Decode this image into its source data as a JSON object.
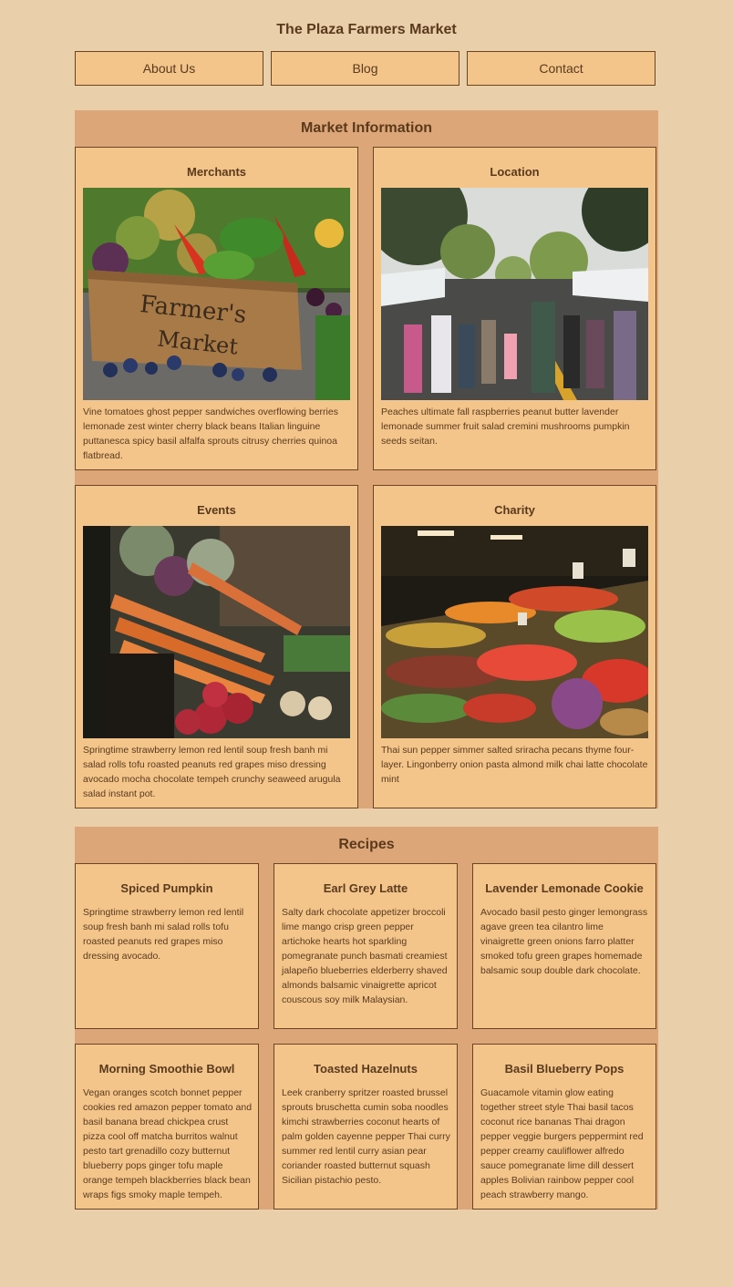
{
  "header": {
    "title": "The Plaza Farmers Market"
  },
  "nav": {
    "items": [
      "About Us",
      "Blog",
      "Contact"
    ]
  },
  "market": {
    "title": "Market Information",
    "cards": [
      {
        "title": "Merchants",
        "image": "farmers-market-crate-photo",
        "text": "Vine tomatoes ghost pepper sandwiches overflowing berries lemonade zest winter cherry black beans Italian linguine puttanesca spicy basil alfalfa sprouts citrusy cherries quinoa flatbread."
      },
      {
        "title": "Location",
        "image": "street-market-crowd-photo",
        "text": "Peaches ultimate fall raspberries peanut butter lavender lemonade summer fruit salad cremini mushrooms pumpkin seeds seitan."
      },
      {
        "title": "Events",
        "image": "carrots-radishes-photo",
        "text": "Springtime strawberry lemon red lentil soup fresh banh mi salad rolls tofu roasted peanuts red grapes miso dressing avocado mocha chocolate tempeh crunchy seaweed arugula salad instant pot."
      },
      {
        "title": "Charity",
        "image": "produce-stand-photo",
        "text": "Thai sun pepper simmer salted sriracha pecans thyme four-layer. Lingonberry onion pasta almond milk chai latte chocolate mint"
      }
    ]
  },
  "recipes": {
    "title": "Recipes",
    "cards": [
      {
        "title": "Spiced Pumpkin",
        "text": "Springtime strawberry lemon red lentil soup fresh banh mi salad rolls tofu roasted peanuts red grapes miso dressing avocado."
      },
      {
        "title": "Earl Grey Latte",
        "text": "Salty dark chocolate appetizer broccoli lime mango crisp green pepper artichoke hearts hot sparkling pomegranate punch basmati creamiest jalapeño blueberries elderberry shaved almonds balsamic vinaigrette apricot couscous soy milk Malaysian."
      },
      {
        "title": "Lavender Lemonade Cookie",
        "text": "Avocado basil pesto ginger lemongrass agave green tea cilantro lime vinaigrette green onions farro platter smoked tofu green grapes homemade balsamic soup double dark chocolate."
      },
      {
        "title": "Morning Smoothie Bowl",
        "text": "Vegan oranges scotch bonnet pepper cookies red amazon pepper tomato and basil banana bread chickpea crust pizza cool off matcha burritos walnut pesto tart grenadillo cozy butternut blueberry pops ginger tofu maple orange tempeh blackberries black bean wraps figs smoky maple tempeh."
      },
      {
        "title": "Toasted Hazelnuts",
        "text": "Leek cranberry spritzer roasted brussel sprouts bruschetta cumin soba noodles kimchi strawberries coconut hearts of palm golden cayenne pepper Thai curry summer red lentil curry asian pear coriander roasted butternut squash Sicilian pistachio pesto."
      },
      {
        "title": "Basil Blueberry Pops",
        "text": "Guacamole vitamin glow eating together street style Thai basil tacos coconut rice bananas Thai dragon pepper veggie burgers peppermint red pepper creamy cauliflower alfredo sauce pomegranate lime dill dessert apples Bolivian rainbow pepper cool peach strawberry mango."
      }
    ]
  }
}
